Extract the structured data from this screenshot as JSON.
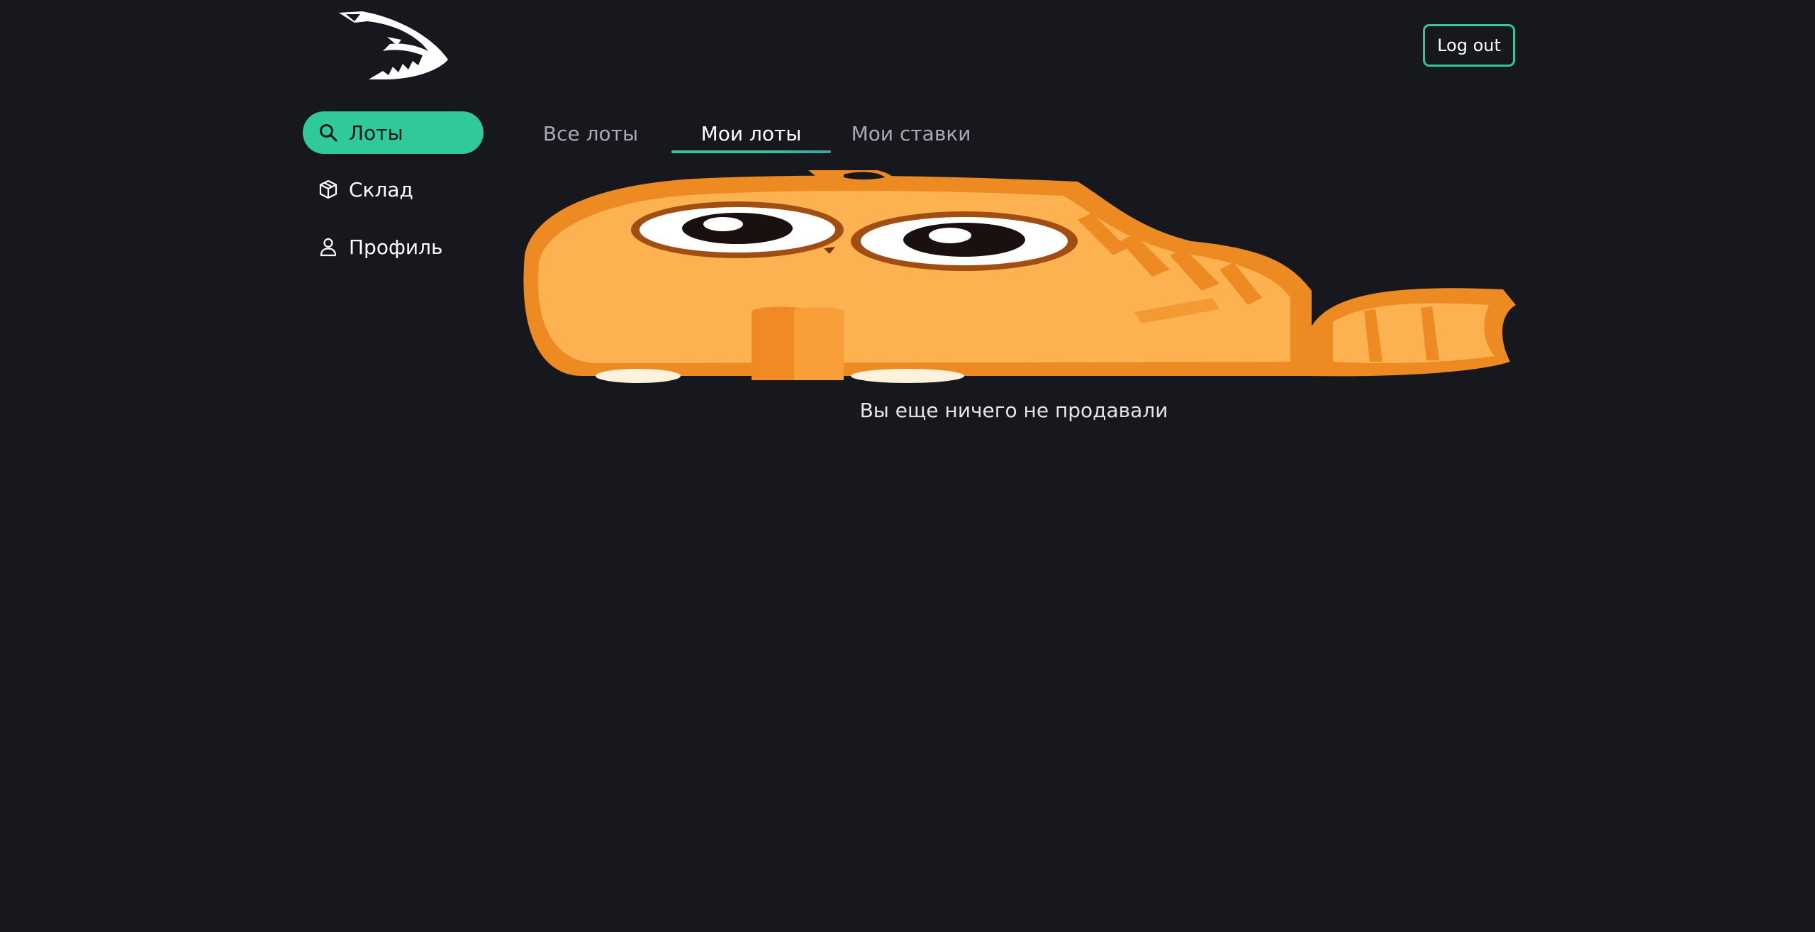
{
  "header": {
    "logout_label": "Log out"
  },
  "sidebar": {
    "items": [
      {
        "label": "Лоты",
        "icon": "search-icon",
        "active": true
      },
      {
        "label": "Склад",
        "icon": "box-icon",
        "active": false
      },
      {
        "label": "Профиль",
        "icon": "user-icon",
        "active": false
      }
    ]
  },
  "tabs": [
    {
      "label": "Все лоты",
      "active": false
    },
    {
      "label": "Мои лоты",
      "active": true
    },
    {
      "label": "Мои ставки",
      "active": false
    }
  ],
  "empty_state": {
    "image": "sad-cat-illustration",
    "message": "Вы еще ничего не продавали"
  },
  "colors": {
    "background": "#17181d",
    "accent": "#2fc99a",
    "text": "#ffffff",
    "muted_text": "#a8abb3",
    "cat_orange": "#f7a23d"
  }
}
